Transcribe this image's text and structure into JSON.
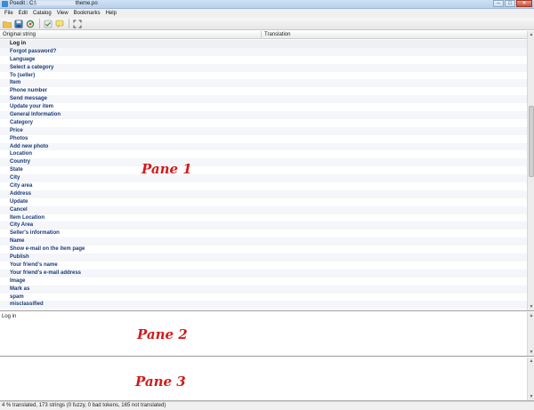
{
  "window": {
    "title_prefix": "Poedit : C:\\",
    "title_suffix": "theme.po",
    "minimize": "–",
    "maximize": "□",
    "close": "✕"
  },
  "menu": [
    "File",
    "Edit",
    "Catalog",
    "View",
    "Bookmarks",
    "Help"
  ],
  "toolbar": {
    "icons": [
      "open-folder-icon",
      "save-icon",
      "update-catalog-icon",
      "validate-icon",
      "comment-icon",
      "fullscreen-icon"
    ]
  },
  "pane1": {
    "headers": {
      "original": "Original string",
      "translation": "Translation"
    },
    "rows": [
      "Log in",
      "Forgot password?",
      "Language",
      "Select a category",
      "To (seller)",
      "Item",
      "Phone number",
      "Send message",
      "Update your item",
      "General Information",
      "Category",
      "Price",
      "Photos",
      "Add new photo",
      "Location",
      "Country",
      "State",
      "City",
      "City area",
      "Address",
      "Update",
      "Cancel",
      "Item Location",
      "City Area",
      "Seller's information",
      "Name",
      "Show e-mail on the item page",
      "Publish",
      "Your friend's name",
      "Your friend's e-mail address",
      "Image",
      "Mark as",
      "spam",
      "misclassified"
    ],
    "annotation": "Pane 1"
  },
  "pane2": {
    "text": "Log in",
    "annotation": "Pane 2"
  },
  "pane3": {
    "annotation": "Pane 3"
  },
  "status": {
    "text": "4 % translated, 173 strings (0 fuzzy, 0 bad tokens, 165 not translated)"
  },
  "colors": {
    "string_text": "#1a3a7a",
    "annotation": "#d11a1a",
    "close_button": "#c9503b"
  }
}
